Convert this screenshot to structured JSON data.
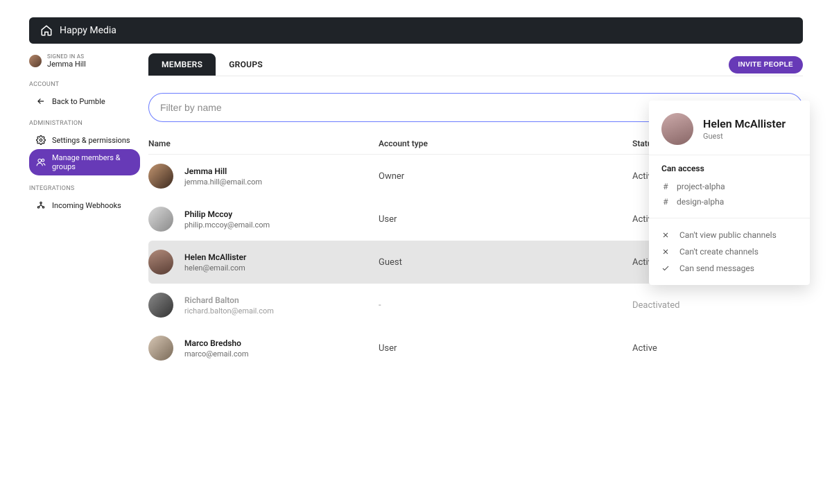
{
  "header": {
    "brand": "Happy Media"
  },
  "user": {
    "signed_in_as_label": "SIGNED IN AS",
    "name": "Jemma Hill"
  },
  "sidebar": {
    "account_label": "ACCOUNT",
    "back_label": "Back to Pumble",
    "admin_label": "ADMINISTRATION",
    "settings_label": "Settings & permissions",
    "manage_label": "Manage members & groups",
    "integrations_label": "INTEGRATIONS",
    "webhooks_label": "Incoming Webhooks"
  },
  "tabs": {
    "members": "MEMBERS",
    "groups": "GROUPS"
  },
  "invite_button": "INVITE PEOPLE",
  "filter_placeholder": "Filter by name",
  "columns": {
    "name": "Name",
    "type": "Account type",
    "status": "Status"
  },
  "members": [
    {
      "name": "Jemma Hill",
      "email": "jemma.hill@email.com",
      "type": "Owner",
      "status": "Active"
    },
    {
      "name": "Philip Mccoy",
      "email": "philip.mccoy@email.com",
      "type": "User",
      "status": "Active"
    },
    {
      "name": "Helen McAllister",
      "email": "helen@email.com",
      "type": "Guest",
      "status": "Active"
    },
    {
      "name": "Richard Balton",
      "email": "richard.balton@email.com",
      "type": "-",
      "status": "Deactivated"
    },
    {
      "name": "Marco Bredsho",
      "email": "marco@email.com",
      "type": "User",
      "status": "Active"
    }
  ],
  "popover": {
    "name": "Helen McAllister",
    "role": "Guest",
    "can_access_label": "Can access",
    "channels": [
      "project-alpha",
      "design-alpha"
    ],
    "perms": [
      {
        "icon": "x",
        "text": "Can't view public channels"
      },
      {
        "icon": "x",
        "text": "Can't create channels"
      },
      {
        "icon": "check",
        "text": "Can send messages"
      }
    ]
  }
}
